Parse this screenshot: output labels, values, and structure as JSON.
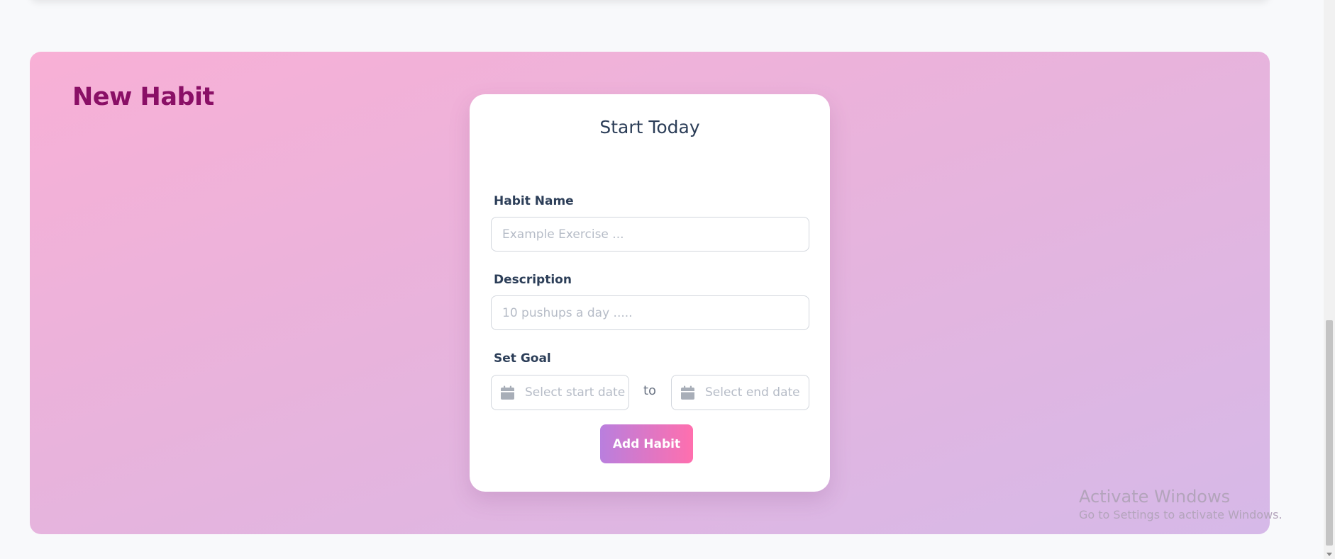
{
  "section": {
    "title": "New Habit"
  },
  "form": {
    "title": "Start Today",
    "habit_name": {
      "label": "Habit Name",
      "placeholder": "Example Exercise ...",
      "value": ""
    },
    "description": {
      "label": "Description",
      "placeholder": "10 pushups a day .....",
      "value": ""
    },
    "goal": {
      "label": "Set Goal",
      "start_placeholder": "Select start date",
      "separator": "to",
      "end_placeholder": "Select end date",
      "icon": "calendar-icon"
    },
    "submit_label": "Add Habit"
  },
  "watermark": {
    "title": "Activate Windows",
    "subtitle": "Go to Settings to activate Windows."
  },
  "colors": {
    "title": "#8a0f66",
    "text": "#2c3e58",
    "button_gradient_start": "#b97fde",
    "button_gradient_end": "#ff6fae",
    "panel_gradient_start": "#f8b0d6",
    "panel_gradient_end": "#d6b9e8"
  }
}
